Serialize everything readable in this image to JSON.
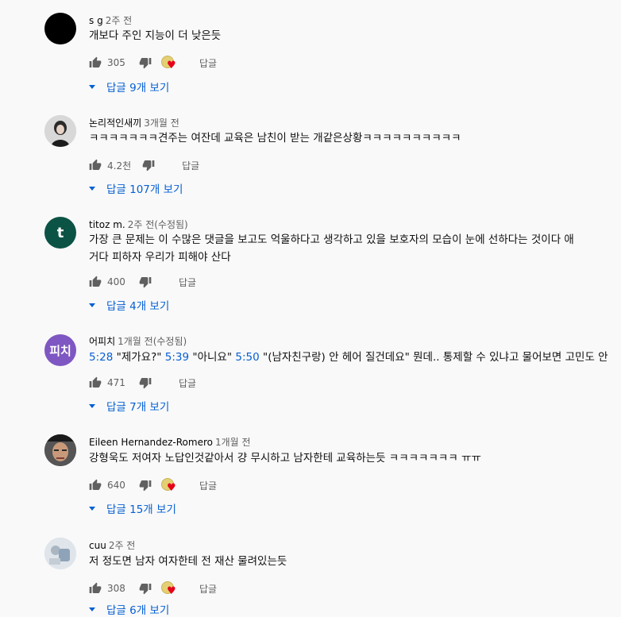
{
  "comments": [
    {
      "author": "s g",
      "time": "2주 전",
      "lines": [
        "개보다 주인 지능이 더 낮은듯"
      ],
      "likes": "305",
      "reply_label": "답글",
      "replies_label": "답글 9개 보기",
      "creator_heart": true,
      "avatar": "black-circle"
    },
    {
      "author": "논리적인새끼",
      "time": "3개월 전",
      "lines": [
        "ㅋㅋㅋㅋㅋㅋㅋ견주는 여잔데 교육은 남친이 받는 개같은상황ㅋㅋㅋㅋㅋㅋㅋㅋㅋㅋ"
      ],
      "likes": "4.2천",
      "reply_label": "답글",
      "replies_label": "답글 107개 보기",
      "creator_heart": false,
      "avatar": "photo-person"
    },
    {
      "author": "titoz m.",
      "time": "2주 전(수정됨)",
      "lines": [
        "가장 큰 문제는 이 수많은 댓글을 보고도 억울하다고 생각하고 있을 보호자의 모습이 눈에 선하다는 것이다 애",
        "거다 피하자 우리가 피해야 산다"
      ],
      "likes": "400",
      "reply_label": "답글",
      "replies_label": "답글 4개 보기",
      "creator_heart": false,
      "avatar": "letter",
      "avatar_text": "t",
      "avatar_color": "#0b5345"
    },
    {
      "author": "어피치",
      "time": "1개월 전(수정됨)",
      "segments": [
        {
          "ts": "5:28"
        },
        {
          "t": " \"제가요?\" "
        },
        {
          "ts": "5:39"
        },
        {
          "t": " \"아니요\" "
        },
        {
          "ts": "5:50"
        },
        {
          "t": " \"(남자친구랑) 안 헤어 질건데요\" 뭔데.. 통제할 수 있냐고 물어보면 고민도 안"
        }
      ],
      "likes": "471",
      "reply_label": "답글",
      "replies_label": "답글 7개 보기",
      "creator_heart": false,
      "avatar": "letter",
      "avatar_text": "피치",
      "avatar_color": "#7e57c2"
    },
    {
      "author": "Eileen Hernandez-Romero",
      "time": "1개월 전",
      "lines": [
        "강형욱도 저여자 노답인것같아서 걍 무시하고 남자한테 교육하는듯 ㅋㅋㅋㅋㅋㅋㅋ ㅠㅠ"
      ],
      "likes": "640",
      "reply_label": "답글",
      "replies_label": "답글 15개 보기",
      "creator_heart": true,
      "avatar": "photo-face"
    },
    {
      "author": "cuu",
      "time": "2주 전",
      "lines": [
        "저 정도면 남자 여자한테 전 재산 물려있는듯"
      ],
      "likes": "308",
      "reply_label": "답글",
      "replies_label": "답글 6개 보기",
      "creator_heart": true,
      "avatar": "photo-light"
    }
  ],
  "colors": {
    "background": "#f9f9f9",
    "link_blue": "#065fd4",
    "secondary_text": "#606060",
    "heart_red": "#e6001a"
  }
}
